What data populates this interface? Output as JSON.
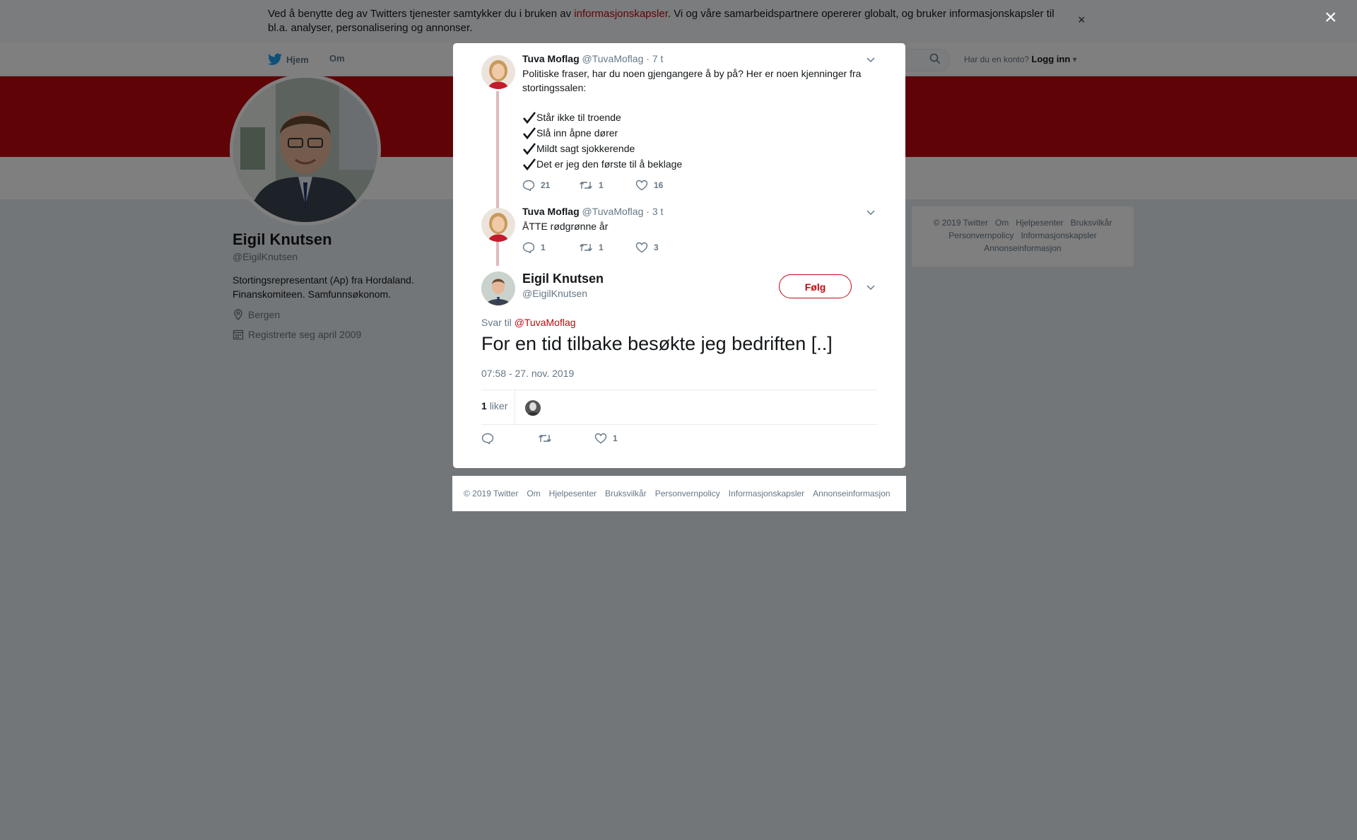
{
  "cookie_banner": {
    "text_before": "Ved å benytte deg av Twitters tjenester samtykker du i bruken av ",
    "link": "informasjonskapsler",
    "text_after": ". Vi og våre samarbeidspartnere opererer globalt, og bruker informasjonskapsler til bl.a. analyser, personalisering og annonser.",
    "close": "×"
  },
  "nav": {
    "home": "Hjem",
    "about": "Om",
    "account_prompt": "Har du en konto?",
    "login": "Logg inn"
  },
  "profile": {
    "name": "Eigil Knutsen",
    "handle": "@EigilKnutsen",
    "bio": "Stortingsrepresentant (Ap) fra Hordaland. Finanskomiteen. Samfunnsøkonom.",
    "location": "Bergen",
    "joined": "Registrerte seg april 2009"
  },
  "side_footer": [
    "© 2019 Twitter",
    "Om",
    "Hjelpesenter",
    "Bruksvilkår",
    "Personvernpolicy",
    "Informasjonskapsler",
    "Annonseinformasjon"
  ],
  "overlay": {
    "close": "×"
  },
  "thread": [
    {
      "name": "Tuva Moflag",
      "handle": "@TuvaMoflag",
      "time": "· 7 t",
      "text": "Politiske fraser, har du noen gjengangere å by på? Her er noen kjenninger fra stortingssalen:",
      "checklist": [
        "Står ikke til troende",
        "Slå inn åpne dører",
        "Mildt sagt sjokkerende",
        "Det er jeg den første til å beklage"
      ],
      "replies": "21",
      "retweets": "1",
      "likes": "16"
    },
    {
      "name": "Tuva Moflag",
      "handle": "@TuvaMoflag",
      "time": "· 3 t",
      "text": "ÅTTE rødgrønne år",
      "replies": "1",
      "retweets": "1",
      "likes": "3"
    }
  ],
  "main_tweet": {
    "name": "Eigil Knutsen",
    "handle": "@EigilKnutsen",
    "follow": "Følg",
    "reply_to_label": "Svar til",
    "reply_to_handle": "@TuvaMoflag",
    "text": "For en tid tilbake besøkte jeg bedriften [..]",
    "timestamp": "07:58 - 27. nov. 2019",
    "likes_count": "1",
    "likes_label": "liker",
    "action_likes": "1"
  },
  "modal_footer": [
    "© 2019 Twitter",
    "Om",
    "Hjelpesenter",
    "Bruksvilkår",
    "Personvernpolicy",
    "Informasjonskapsler",
    "Annonseinformasjon"
  ],
  "colors": {
    "accent": "#c0070f",
    "muted": "#657786",
    "thread_line": "#e0b8bd"
  },
  "icons": [
    "twitter-bird-icon",
    "search-icon",
    "location-icon",
    "calendar-icon",
    "reply-icon",
    "retweet-icon",
    "heart-icon",
    "chevron-down-icon",
    "checkmark-icon",
    "close-icon"
  ]
}
